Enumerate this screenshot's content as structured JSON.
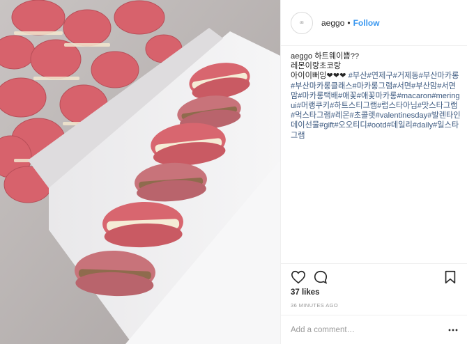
{
  "header": {
    "username": "aeggo",
    "separator": "•",
    "follow_label": "Follow",
    "avatar_icon": "aeggo-logo-icon"
  },
  "post_image": {
    "subject": "heart-shaped-macarons-in-box"
  },
  "caption": {
    "username": "aeggo",
    "line1": "하트웨이쁨??",
    "line2": "레몬이랑초코랑",
    "line3_text": "아이이뻐잉",
    "line3_hearts": "❤❤❤",
    "hashtags": "#부산#연제구#거제동#부산마카롱#부산마카롱클래스#마카롱그램#서면#부산맘#서면맘#마카롱택배#애꽃#애꽃마카롱#macaron#meringui#머랭쿠키#하트스티그램#럽스타아님#맛스타그램#먹스타그램#레몬#초콜렛#valentinesday#발렌타인데이선물#gift#오오티디#ootd#데일리#daily#일스타그램"
  },
  "actions": {
    "like_icon": "heart-outline-icon",
    "comment_icon": "comment-bubble-icon",
    "save_icon": "bookmark-icon"
  },
  "likes_text": "37 likes",
  "timestamp": "36 MINUTES AGO",
  "comment": {
    "placeholder": "Add a comment…",
    "more_icon": "more-options-icon"
  },
  "colors": {
    "link": "#3897f0",
    "hashtag": "#3d5a80",
    "macaron_pink": "#d9666f",
    "filling_cream": "#f5ecd6"
  }
}
